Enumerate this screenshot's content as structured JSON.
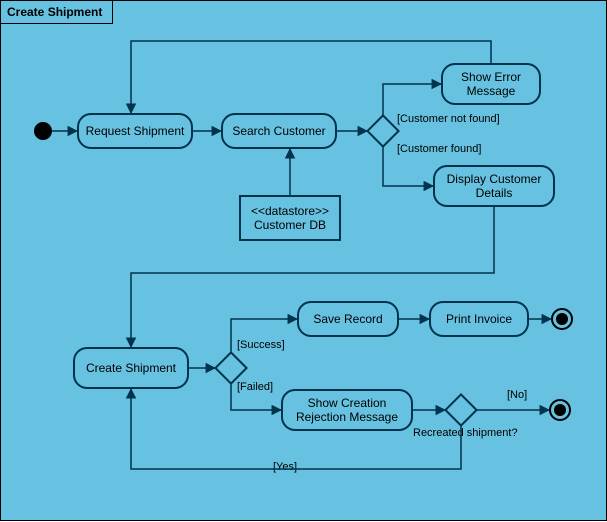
{
  "frame": {
    "title": "Create Shipment"
  },
  "nodes": {
    "requestShipment": "Request Shipment",
    "searchCustomer": "Search Customer",
    "showError": "Show Error Message",
    "displayCustomer": "Display Customer Details",
    "datastoreStereotype": "<<datastore>>",
    "datastoreName": "Customer DB",
    "createShipment": "Create Shipment",
    "saveRecord": "Save Record",
    "printInvoice": "Print Invoice",
    "showRejection": "Show Creation Rejection Message"
  },
  "guards": {
    "custNotFound": "[Customer not found]",
    "custFound": "[Customer found]",
    "success": "[Success]",
    "failed": "[Failed]",
    "no": "[No]",
    "yes": "[Yes]",
    "recreateQ": "Recreated shipment?"
  },
  "chart_data": {
    "type": "uml-activity",
    "title": "Create Shipment",
    "initial": "start1",
    "nodes": [
      {
        "id": "start1",
        "kind": "initial"
      },
      {
        "id": "requestShipment",
        "kind": "activity",
        "label": "Request Shipment"
      },
      {
        "id": "searchCustomer",
        "kind": "activity",
        "label": "Search Customer"
      },
      {
        "id": "customerDB",
        "kind": "datastore",
        "stereotype": "<<datastore>>",
        "label": "Customer DB"
      },
      {
        "id": "decision1",
        "kind": "decision"
      },
      {
        "id": "showError",
        "kind": "activity",
        "label": "Show Error Message"
      },
      {
        "id": "displayCustomer",
        "kind": "activity",
        "label": "Display Customer Details"
      },
      {
        "id": "createShipment",
        "kind": "activity",
        "label": "Create Shipment"
      },
      {
        "id": "decision2",
        "kind": "decision"
      },
      {
        "id": "saveRecord",
        "kind": "activity",
        "label": "Save Record"
      },
      {
        "id": "printInvoice",
        "kind": "activity",
        "label": "Print Invoice"
      },
      {
        "id": "end1",
        "kind": "final"
      },
      {
        "id": "showRejection",
        "kind": "activity",
        "label": "Show Creation Rejection Message"
      },
      {
        "id": "decision3",
        "kind": "decision",
        "question": "Recreated shipment?"
      },
      {
        "id": "end2",
        "kind": "final"
      }
    ],
    "edges": [
      {
        "from": "start1",
        "to": "requestShipment"
      },
      {
        "from": "requestShipment",
        "to": "searchCustomer"
      },
      {
        "from": "customerDB",
        "to": "searchCustomer"
      },
      {
        "from": "searchCustomer",
        "to": "decision1"
      },
      {
        "from": "decision1",
        "to": "showError",
        "guard": "[Customer not found]"
      },
      {
        "from": "showError",
        "to": "requestShipment"
      },
      {
        "from": "decision1",
        "to": "displayCustomer",
        "guard": "[Customer found]"
      },
      {
        "from": "displayCustomer",
        "to": "createShipment"
      },
      {
        "from": "createShipment",
        "to": "decision2"
      },
      {
        "from": "decision2",
        "to": "saveRecord",
        "guard": "[Success]"
      },
      {
        "from": "saveRecord",
        "to": "printInvoice"
      },
      {
        "from": "printInvoice",
        "to": "end1"
      },
      {
        "from": "decision2",
        "to": "showRejection",
        "guard": "[Failed]"
      },
      {
        "from": "showRejection",
        "to": "decision3"
      },
      {
        "from": "decision3",
        "to": "end2",
        "guard": "[No]"
      },
      {
        "from": "decision3",
        "to": "createShipment",
        "guard": "[Yes]"
      }
    ]
  }
}
